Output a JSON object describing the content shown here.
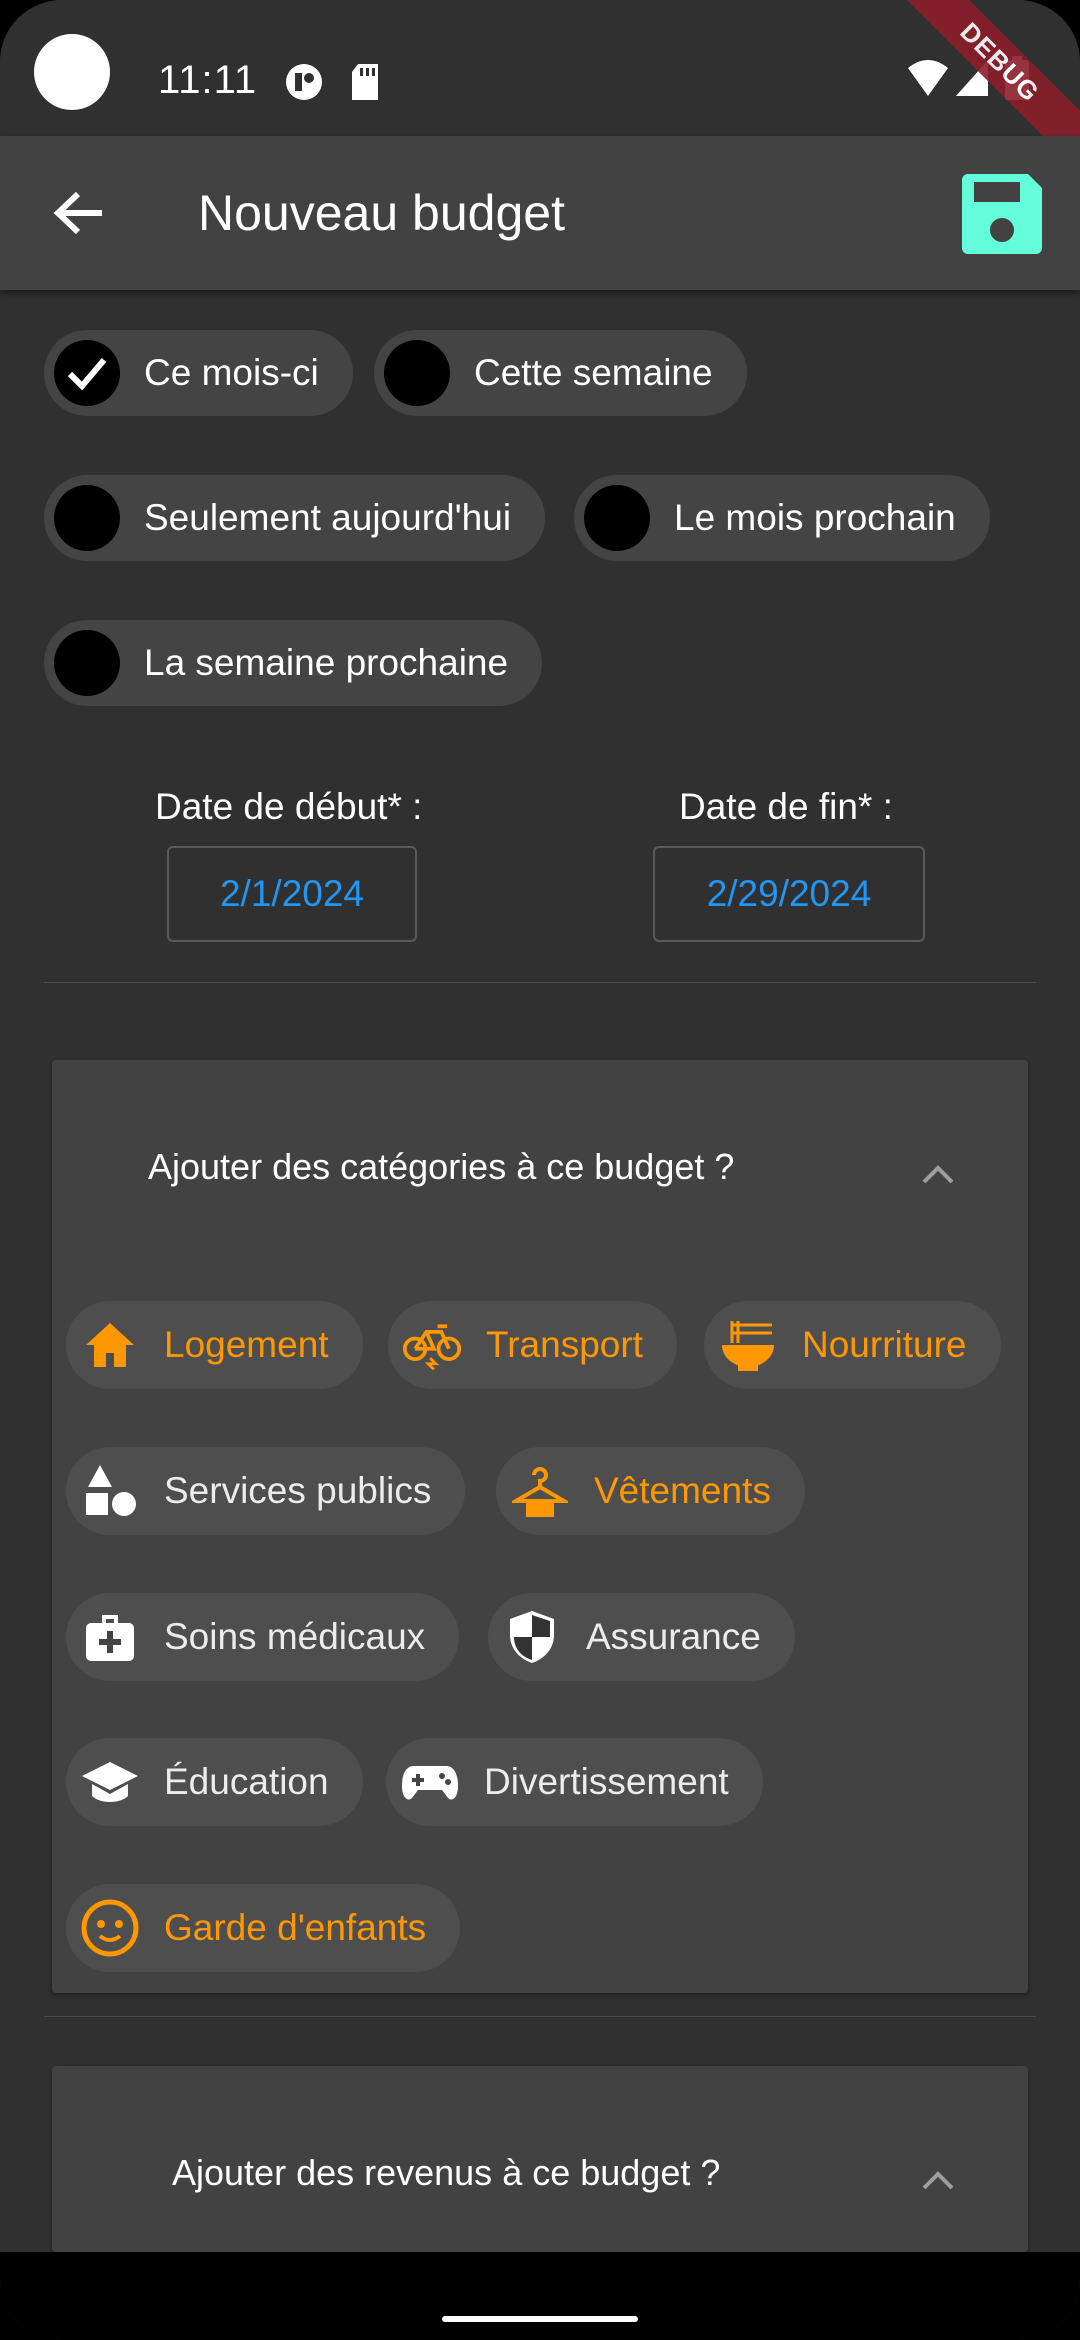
{
  "status": {
    "time": "11:11",
    "debug_label": "DEBUG"
  },
  "appbar": {
    "title": "Nouveau budget"
  },
  "periods": [
    {
      "label": "Ce mois-ci",
      "selected": true
    },
    {
      "label": "Cette semaine",
      "selected": false
    },
    {
      "label": "Seulement aujourd'hui",
      "selected": false
    },
    {
      "label": "Le mois prochain",
      "selected": false
    },
    {
      "label": "La semaine prochaine",
      "selected": false
    }
  ],
  "dates": {
    "start_label": "Date de début* :",
    "start_value": "2/1/2024",
    "end_label": "Date de fin* :",
    "end_value": "2/29/2024"
  },
  "categories_panel": {
    "title": "Ajouter des catégories à ce budget ?",
    "items": [
      {
        "label": "Logement",
        "icon": "home-icon",
        "selected": true
      },
      {
        "label": "Transport",
        "icon": "bike-icon",
        "selected": true
      },
      {
        "label": "Nourriture",
        "icon": "ramen-bowl-icon",
        "selected": true
      },
      {
        "label": "Services publics",
        "icon": "shapes-icon",
        "selected": false
      },
      {
        "label": "Vêtements",
        "icon": "hanger-icon",
        "selected": true
      },
      {
        "label": "Soins médicaux",
        "icon": "medical-bag-icon",
        "selected": false
      },
      {
        "label": "Assurance",
        "icon": "shield-icon",
        "selected": false
      },
      {
        "label": "Éducation",
        "icon": "graduation-cap-icon",
        "selected": false
      },
      {
        "label": "Divertissement",
        "icon": "gamepad-icon",
        "selected": false
      },
      {
        "label": "Garde d'enfants",
        "icon": "baby-face-icon",
        "selected": true
      }
    ]
  },
  "income_panel": {
    "title": "Ajouter des revenus à ce budget ?"
  },
  "colors": {
    "accent_selected": "#ff9800",
    "date_blue": "#2196f3",
    "save_teal": "#64ffda"
  }
}
